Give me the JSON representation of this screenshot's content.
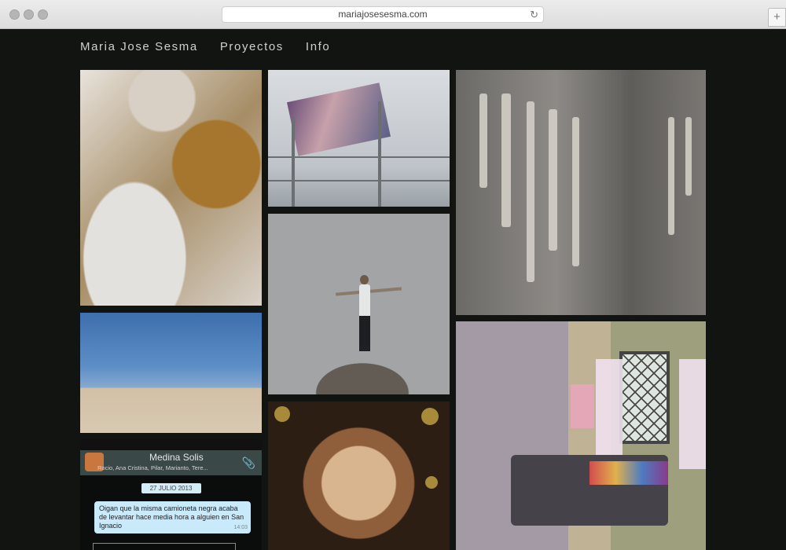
{
  "browser": {
    "url": "mariajosesesma.com",
    "new_tab": "+"
  },
  "nav": {
    "site_name": "Maria Jose Sesma",
    "projects": "Proyectos",
    "info": "Info"
  },
  "gallery": {
    "images": [
      "vanity-table-photo",
      "desert-sky-photo",
      "chat-screenshot",
      "billboard-photo",
      "man-on-rock-photo",
      "woman-face-photo",
      "wall-light-shadows-photo",
      "bedroom-photo"
    ]
  },
  "chat": {
    "group_name": "Medina Solis",
    "members": "Rocio, Ana Cristina, Pilar, Marianto, Tere...",
    "date": "27 JULIO 2013",
    "message": "Oigan que la misma camioneta negra acaba de levantar hace media hora a alguien en San Ignacio",
    "time": "14:03"
  }
}
